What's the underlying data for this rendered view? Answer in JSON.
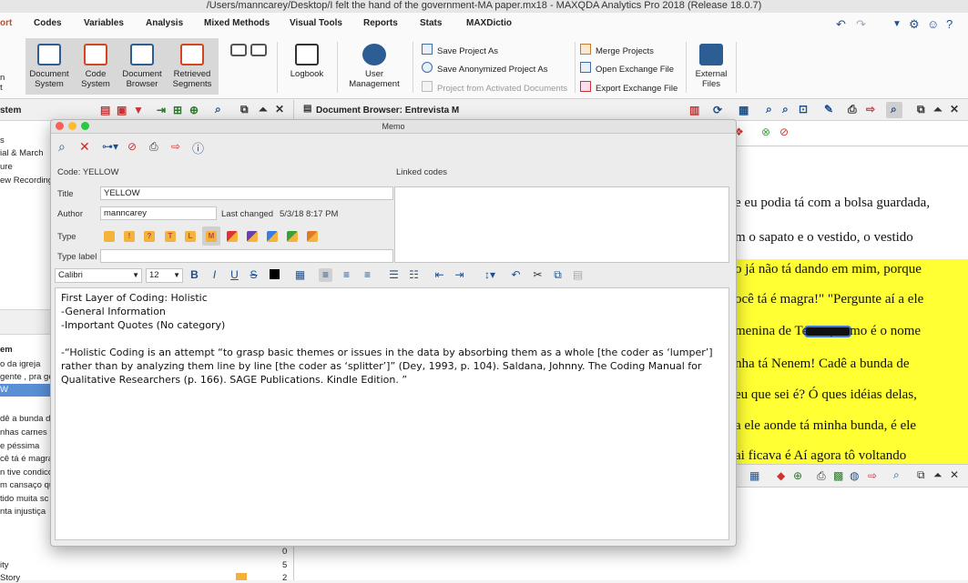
{
  "window": {
    "title": "/Users/manncarey/Desktop/I felt the hand of the government-MA paper.mx18 - MAXQDA Analytics Pro 2018  (Release 18.0.7)"
  },
  "menu": {
    "items": [
      "ort",
      "Codes",
      "Variables",
      "Analysis",
      "Mixed Methods",
      "Visual Tools",
      "Reports",
      "Stats",
      "MAXDictio"
    ]
  },
  "ribbon": {
    "left_cut": [
      "n",
      "t"
    ],
    "large_buttons": [
      {
        "label": "Document\nSystem",
        "icon": "document-system-icon"
      },
      {
        "label": "Code\nSystem",
        "icon": "code-system-icon"
      },
      {
        "label": "Document\nBrowser",
        "icon": "document-browser-icon"
      },
      {
        "label": "Retrieved\nSegments",
        "icon": "retrieved-segments-icon"
      },
      {
        "label": "Logbook",
        "icon": "logbook-icon"
      },
      {
        "label": "User\nManagement",
        "icon": "user-management-icon"
      },
      {
        "label": "External\nFiles",
        "icon": "external-files-icon"
      }
    ],
    "small_buttons": {
      "save_project_as": "Save Project As",
      "save_anonymized": "Save Anonymized Project As",
      "project_from_activated": "Project from Activated Documents",
      "merge_projects": "Merge Projects",
      "open_exchange": "Open Exchange File",
      "export_exchange": "Export Exchange File"
    }
  },
  "left_panel": {
    "title": "stem",
    "top_items": [
      "s",
      "ial & March",
      "ure",
      "ew Recording"
    ],
    "section_title": "em",
    "items": [
      "o da igreja",
      "gente , pra ge",
      "W",
      "dê a bunda de",
      "nhas carnes",
      "e péssima",
      "cê tá é magra",
      "n tive condico",
      "m cansaço qu",
      "tido muita sc",
      "nta injustiça"
    ],
    "bottom_rows": [
      {
        "label": "",
        "count": "0"
      },
      {
        "label": "ity",
        "count": "5"
      },
      {
        "label": "Story",
        "count": "2"
      }
    ]
  },
  "right_panel": {
    "title": "Document Browser: Entrevista M",
    "lines": [
      "e eu podia tá com a bolsa guardada,",
      "m o sapato e o vestido, o vestido",
      "o  já não tá dando em mim, porque",
      "ocê tá é magra!\"  \"Pergunte  aí a ele",
      "menina de Teresa, como é o nome",
      "nha  tá  Nenem!  Cadê  a  bunda  de",
      "  eu que sei é? Ó ques idéias delas,",
      "  a ele aonde tá minha bunda, é ele",
      "ai ficava  é  Aí agora tô voltando"
    ]
  },
  "memo": {
    "window_title": "Memo",
    "code_label": "Code: YELLOW",
    "linked_codes_label": "Linked codes",
    "title_label": "Title",
    "title_value": "YELLOW",
    "author_label": "Author",
    "author_value": "manncarey",
    "last_changed_label": "Last changed",
    "last_changed_value": "5/3/18 8:17 PM",
    "type_label": "Type",
    "type_icons": [
      "",
      "!",
      "?",
      "T",
      "L",
      "M",
      "",
      "",
      "",
      "",
      ""
    ],
    "typelabel_label": "Type label",
    "font_family": "Calibri",
    "font_size": "12",
    "editor_lines": [
      "First Layer of Coding: Holistic",
      "-General Information",
      "-Important Quotes (No category)",
      "",
      "-“Holistic Coding is an attempt “to grasp basic themes or issues in the data by absorbing them as a whole [the coder as ‘lumper’] rather than by analyzing them line by line [the coder as ‘splitter’]” (Dey, 1993, p. 104). Saldana, Johnny. The Coding Manual for Qualitative Researchers (p. 166). SAGE Publications. Kindle Edition. ”"
    ]
  },
  "colors": {
    "accent": "#d2451e",
    "highlight": "#ffff33",
    "selection": "#5a8fd6"
  }
}
